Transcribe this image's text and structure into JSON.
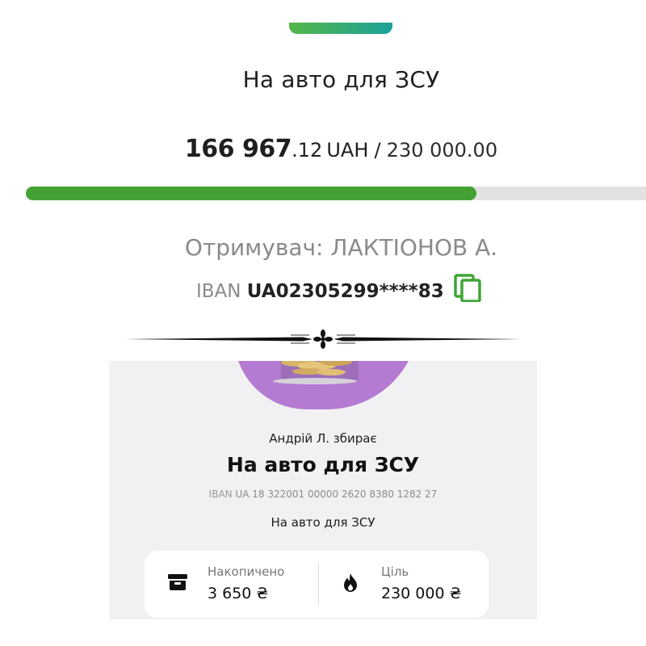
{
  "jar": {
    "title": "На авто для ЗСУ",
    "amount_main": "166 967",
    "amount_cents": ".12",
    "currency": "UAH",
    "separator": "/",
    "target": "230 000.00",
    "progress_fraction": 0.726,
    "recipient": "Отримувач: ЛАКТІОНОВ А.",
    "iban_label": "IBAN",
    "iban_value": "UA02305299****83",
    "copy_icon": "copy-icon",
    "accent_color": "#44a235"
  },
  "card": {
    "collector": "Андрій Л. збирає",
    "title": "На авто для ЗСУ",
    "iban_label": "IBAN",
    "iban_value": "UA 18 322001 00000 2620 8380 1282 27",
    "description": "На авто для ЗСУ",
    "stats": {
      "saved_label": "Накопичено",
      "saved_value": "3 650 ₴",
      "saved_icon": "archive-box-icon",
      "goal_label": "Ціль",
      "goal_value": "230 000 ₴",
      "goal_icon": "flame-icon"
    }
  }
}
